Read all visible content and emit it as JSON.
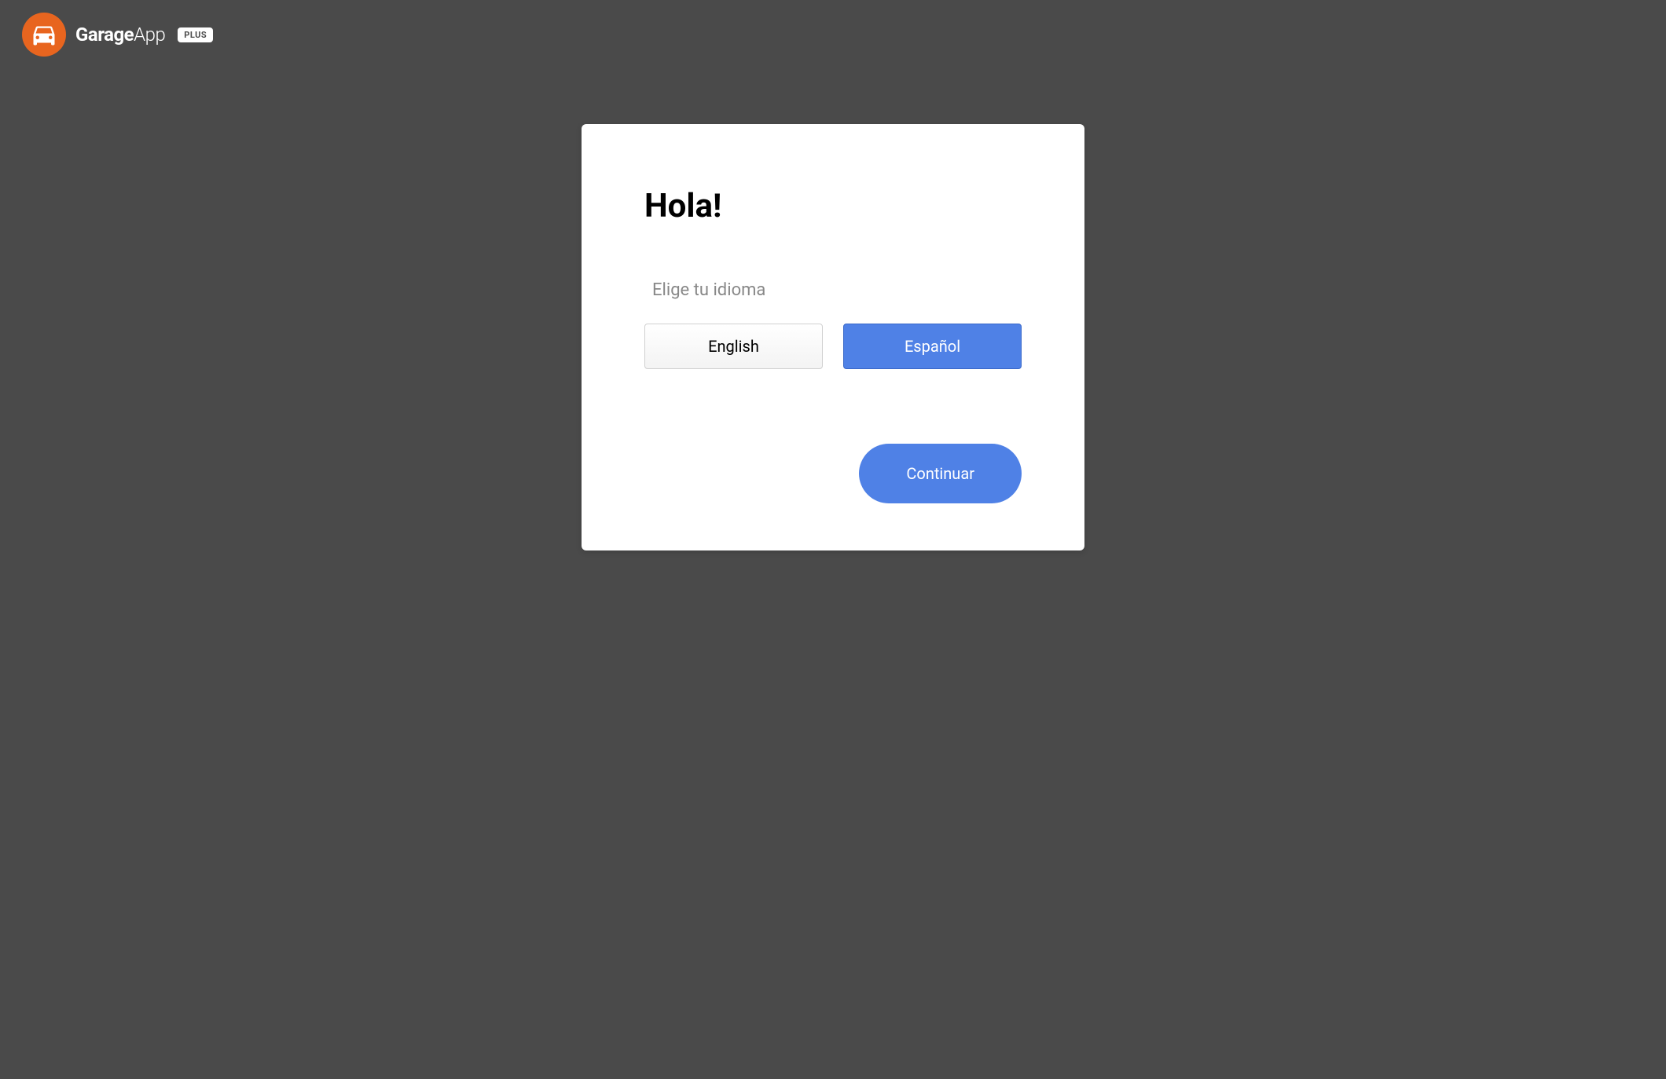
{
  "header": {
    "brand_bold": "Garage",
    "brand_light": "App",
    "badge": "PLUS"
  },
  "card": {
    "greeting": "Hola!",
    "subtitle": "Elige tu idioma",
    "languages": {
      "english": "English",
      "spanish": "Español"
    },
    "continue_label": "Continuar"
  }
}
